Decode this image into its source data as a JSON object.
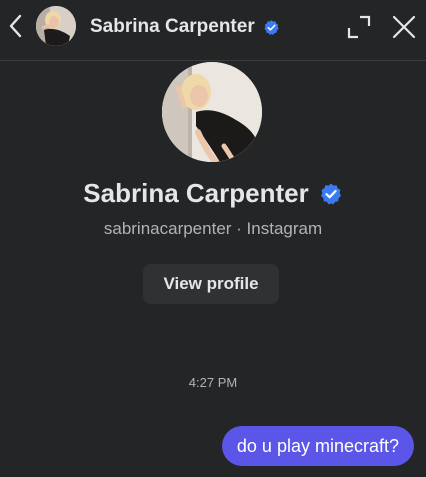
{
  "header": {
    "title": "Sabrina Carpenter",
    "back_icon": "chevron-left-icon",
    "verified_icon": "verified-badge-icon",
    "expand_icon": "expand-icon",
    "close_icon": "close-icon"
  },
  "profile": {
    "name": "Sabrina Carpenter",
    "subtitle": "sabrinacarpenter · Instagram",
    "view_profile_label": "View profile"
  },
  "conversation": {
    "timestamp": "4:27 PM",
    "messages": [
      {
        "sender": "me",
        "text": "do u play minecraft?"
      }
    ]
  },
  "colors": {
    "background": "#242526",
    "verified": "#3b7bf2",
    "bubble": "#5b55e8",
    "button": "#303133",
    "muted_text": "#b0b3b8"
  }
}
